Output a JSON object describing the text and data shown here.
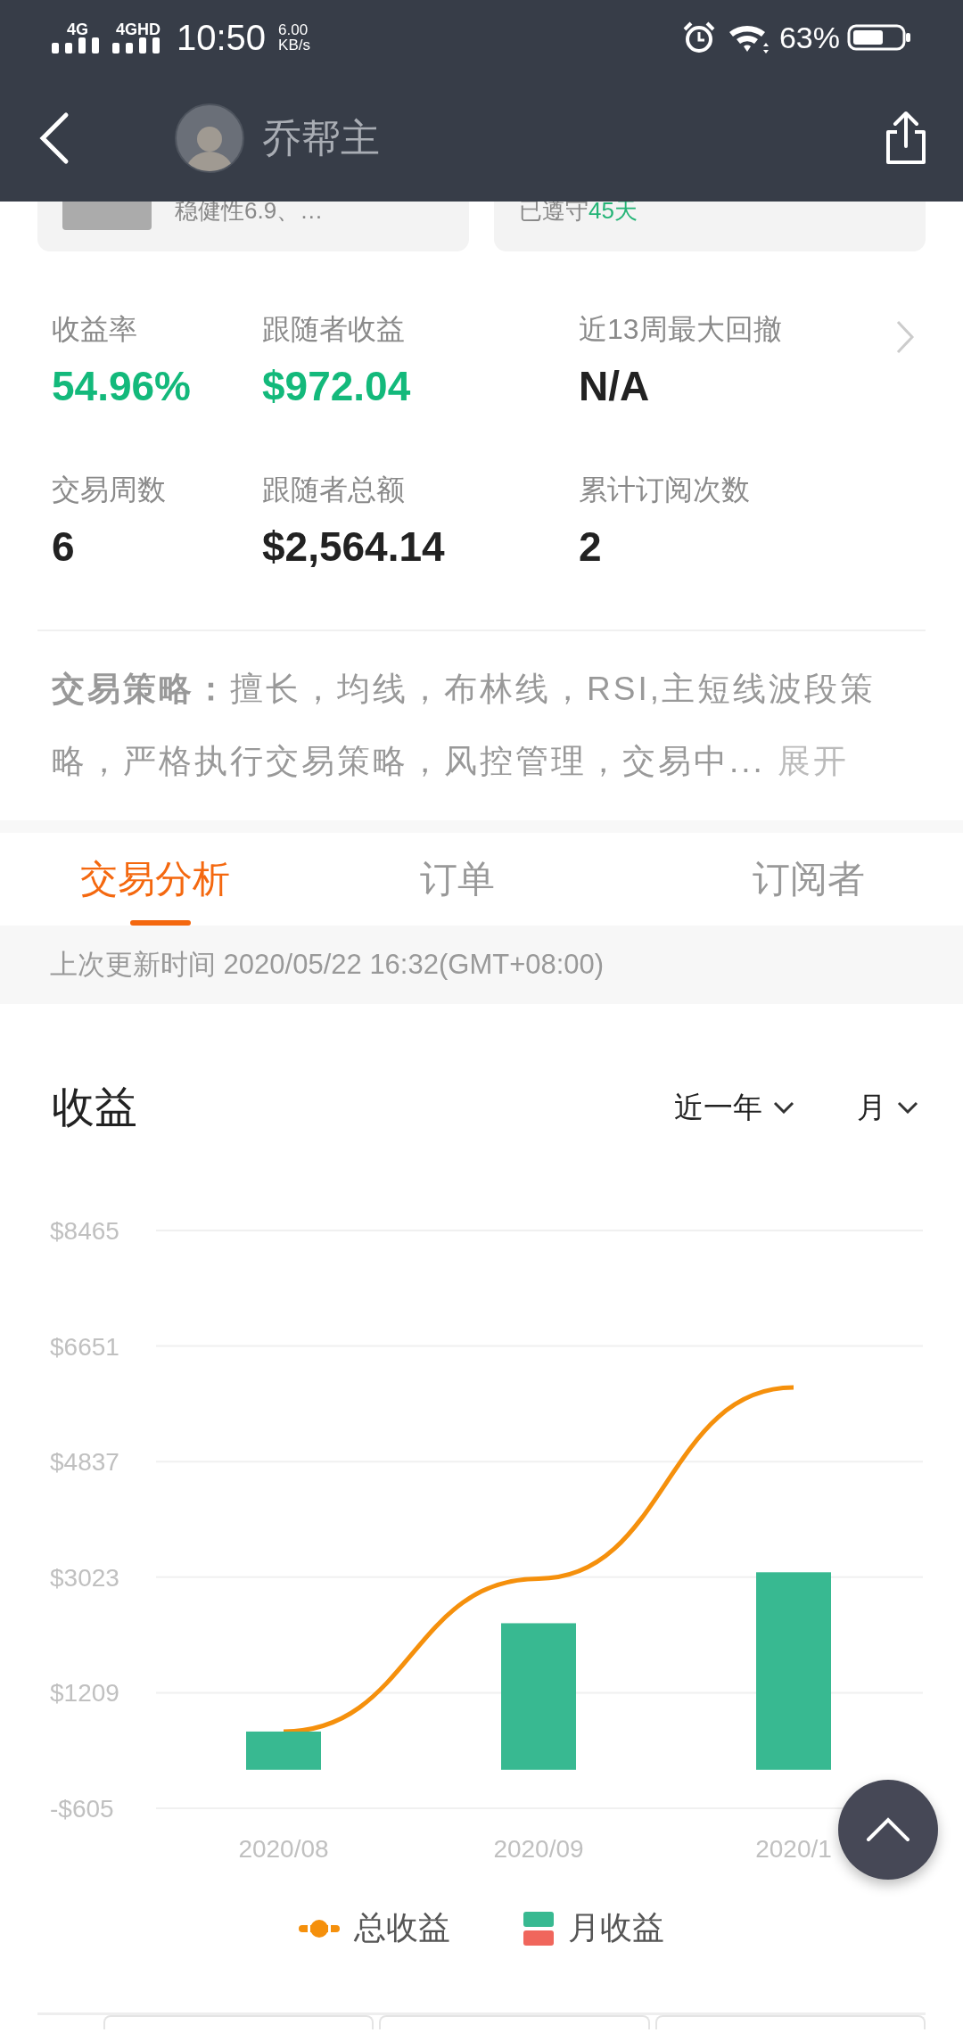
{
  "status_bar": {
    "network_1": "4G",
    "network_2": "4GHD",
    "time": "10:50",
    "speed_value": "6.00",
    "speed_unit": "KB/s",
    "battery": "63%"
  },
  "header": {
    "title": "乔帮主"
  },
  "summary_cards": {
    "left_text": "稳健性6.9、…",
    "follow_label": "已遵守",
    "follow_days": "45天"
  },
  "stats": [
    {
      "label": "收益率",
      "value": "54.96%",
      "kind": "positive"
    },
    {
      "label": "跟随者收益",
      "value": "$972.04",
      "kind": "positive"
    },
    {
      "label": "近13周最大回撤",
      "value": "N/A",
      "kind": "plain"
    },
    {
      "label": "交易周数",
      "value": "6",
      "kind": "plain"
    },
    {
      "label": "跟随者总额",
      "value": "$2,564.14",
      "kind": "plain"
    },
    {
      "label": "累计订阅次数",
      "value": "2",
      "kind": "plain"
    }
  ],
  "strategy": {
    "text": "**交易策略：**擅长，均线，布林线，RSI,主短线波段策略，严格执行交易策略，风控管理，交易中...",
    "expand_link": "展开"
  },
  "tabs": [
    {
      "label": "交易分析",
      "selected": true
    },
    {
      "label": "订单",
      "selected": false
    },
    {
      "label": "订阅者",
      "selected": false
    }
  ],
  "update_info": "上次更新时间 2020/05/22 16:32(GMT+08:00)",
  "earnings": {
    "title": "收益",
    "range_filter": "近一年",
    "period_filter": "月",
    "chart_data": {
      "type": "bar",
      "categories": [
        "2020/08",
        "2020/09",
        "2020/1"
      ],
      "grid": true,
      "series": [
        {
          "name": "总收益",
          "color": "#f5900c",
          "type": "line",
          "values": [
            600,
            3000,
            6000
          ]
        },
        {
          "name": "月收益",
          "color": "#38b991",
          "values": [
            600,
            2300,
            3100
          ]
        }
      ],
      "ylim": [
        -605,
        8465
      ],
      "yticks": [
        {
          "value": -605,
          "label": "-$605"
        },
        {
          "value": 1209,
          "label": "$1209"
        },
        {
          "value": 3023,
          "label": "$3023"
        },
        {
          "value": 4837,
          "label": "$4837"
        },
        {
          "value": 6651,
          "label": "$6651"
        },
        {
          "value": 8465,
          "label": "$8465"
        }
      ]
    }
  }
}
